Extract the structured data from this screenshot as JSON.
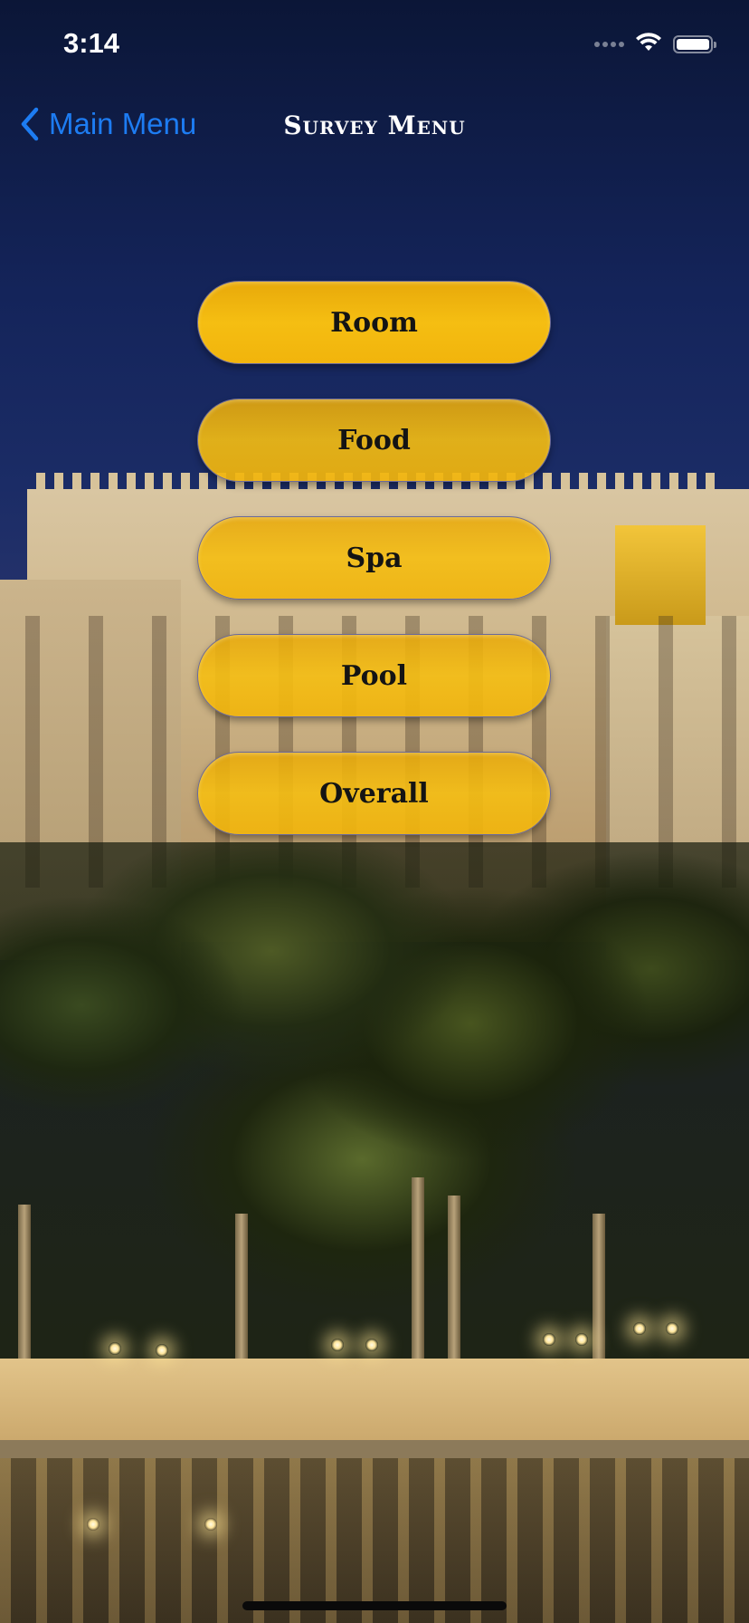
{
  "status_bar": {
    "time": "3:14"
  },
  "nav": {
    "back_label": "Main Menu",
    "title": "Survey Menu"
  },
  "menu": {
    "items": [
      {
        "label": "Room"
      },
      {
        "label": "Food"
      },
      {
        "label": "Spa"
      },
      {
        "label": "Pool"
      },
      {
        "label": "Overall"
      }
    ]
  },
  "colors": {
    "accent_blue": "#1d7cf2",
    "button_gold": "#f5be12",
    "button_border": "#6b6a9a"
  }
}
